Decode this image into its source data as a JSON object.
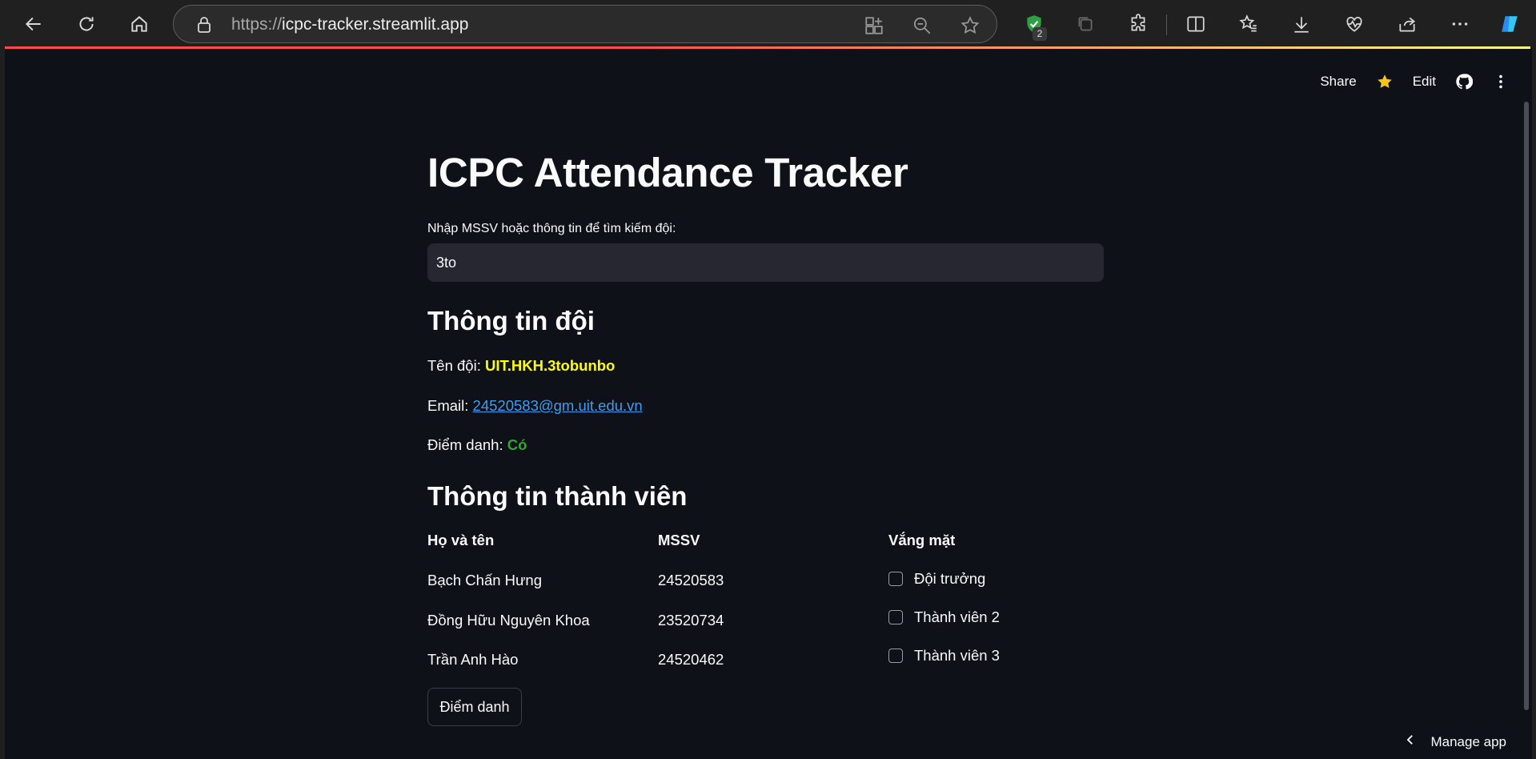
{
  "browser": {
    "url_protocol": "https://",
    "url_host": "icpc-tracker.streamlit.app",
    "extension_badge": "2"
  },
  "app_toolbar": {
    "share_label": "Share",
    "edit_label": "Edit"
  },
  "main": {
    "title": "ICPC Attendance Tracker",
    "search": {
      "label": "Nhập MSSV hoặc thông tin để tìm kiếm đội:",
      "value": "3to"
    },
    "team_section": {
      "heading": "Thông tin đội",
      "team_name_label": "Tên đội:",
      "team_name_value": "UIT.HKH.3tobunbo",
      "email_label": "Email:",
      "email_value": "24520583@gm.uit.edu.vn",
      "attendance_label": "Điểm danh:",
      "attendance_value": "Có"
    },
    "members_section": {
      "heading": "Thông tin thành viên",
      "columns": [
        "Họ và tên",
        "MSSV",
        "Vắng mặt"
      ],
      "rows": [
        {
          "name": "Bạch Chấn Hưng",
          "mssv": "24520583",
          "absent_label": "Đội trưởng",
          "absent_checked": false
        },
        {
          "name": "Đồng Hữu Nguyên Khoa",
          "mssv": "23520734",
          "absent_label": "Thành viên 2",
          "absent_checked": false
        },
        {
          "name": "Trần Anh Hào",
          "mssv": "24520462",
          "absent_label": "Thành viên 3",
          "absent_checked": false
        }
      ]
    },
    "submit_label": "Điểm danh"
  },
  "footer": {
    "manage_label": "Manage app"
  },
  "colors": {
    "app_bg": "#0e1117",
    "text": "#fafafa",
    "team_name": "#ffff00",
    "link": "#3d9df3",
    "attendance_yes": "#2ea82e",
    "star": "#f5c518"
  }
}
